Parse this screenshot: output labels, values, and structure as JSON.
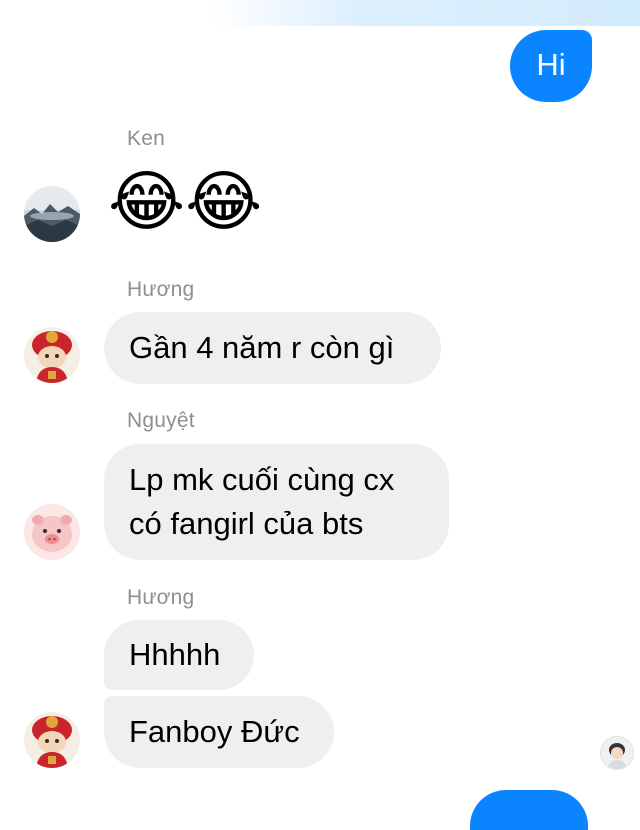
{
  "conversation": {
    "outgoing": [
      {
        "text": "Hi"
      }
    ],
    "groups": [
      {
        "sender": "Ken",
        "messages": [
          "😂😂"
        ]
      },
      {
        "sender": "Hương",
        "messages": [
          "Gần 4 năm r còn gì"
        ]
      },
      {
        "sender": "Nguyệt",
        "messages": [
          "Lp mk cuối cùng cx",
          "có fangirl của bts"
        ]
      },
      {
        "sender": "Hương",
        "messages": [
          "Hhhhh",
          "Fanboy Đức"
        ]
      }
    ]
  },
  "colors": {
    "outgoing_bubble": "#0a84ff",
    "incoming_bubble": "#efefef",
    "sender_name": "#8e8e93"
  }
}
